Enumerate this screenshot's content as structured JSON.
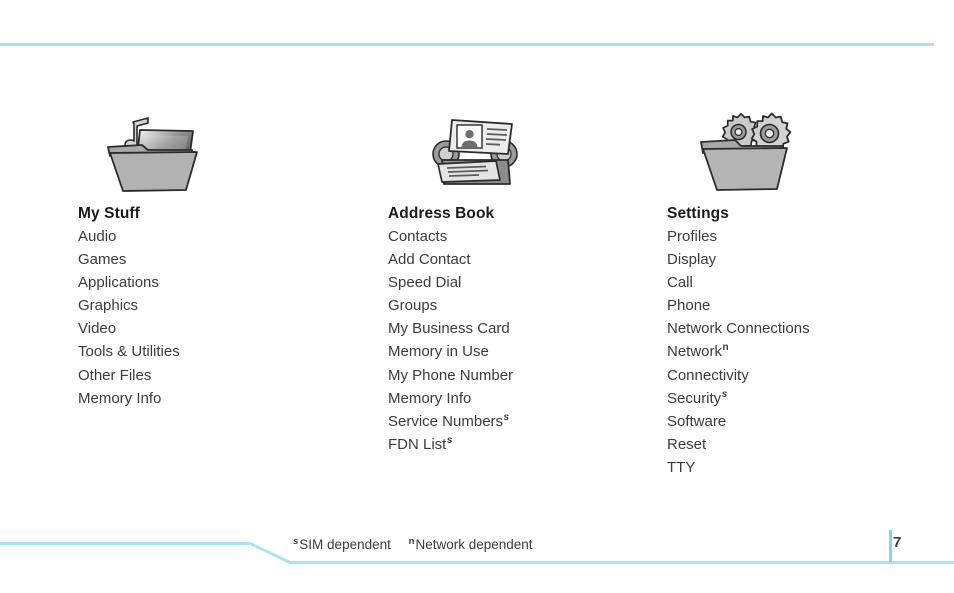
{
  "page": {
    "number": "7",
    "accent_color": "#a9e2f8",
    "text_color": "#3b3b3b"
  },
  "columns": [
    {
      "icon": "folder-media-icon",
      "title": "My Stuff",
      "items": [
        {
          "label": "Audio",
          "mark": ""
        },
        {
          "label": "Games",
          "mark": ""
        },
        {
          "label": "Applications",
          "mark": ""
        },
        {
          "label": "Graphics",
          "mark": ""
        },
        {
          "label": "Video",
          "mark": ""
        },
        {
          "label": "Tools & Utilities",
          "mark": ""
        },
        {
          "label": "Other Files",
          "mark": ""
        },
        {
          "label": "Memory Info",
          "mark": ""
        }
      ]
    },
    {
      "icon": "rolodex-card-file-icon",
      "title": "Address Book",
      "items": [
        {
          "label": "Contacts",
          "mark": ""
        },
        {
          "label": "Add Contact",
          "mark": ""
        },
        {
          "label": "Speed Dial",
          "mark": ""
        },
        {
          "label": "Groups",
          "mark": ""
        },
        {
          "label": "My Business Card",
          "mark": ""
        },
        {
          "label": "Memory in Use",
          "mark": ""
        },
        {
          "label": "My Phone Number",
          "mark": ""
        },
        {
          "label": "Memory Info",
          "mark": ""
        },
        {
          "label": "Service Numbers",
          "mark": "s"
        },
        {
          "label": "FDN List",
          "mark": "s"
        }
      ]
    },
    {
      "icon": "folder-gears-icon",
      "title": "Settings",
      "items": [
        {
          "label": "Profiles",
          "mark": ""
        },
        {
          "label": "Display",
          "mark": ""
        },
        {
          "label": "Call",
          "mark": ""
        },
        {
          "label": "Phone",
          "mark": ""
        },
        {
          "label": "Network Connections",
          "mark": ""
        },
        {
          "label": "Network",
          "mark": "n"
        },
        {
          "label": "Connectivity",
          "mark": ""
        },
        {
          "label": "Security",
          "mark": "s"
        },
        {
          "label": "Software",
          "mark": ""
        },
        {
          "label": "Reset",
          "mark": ""
        },
        {
          "label": "TTY",
          "mark": ""
        }
      ]
    }
  ],
  "legend": [
    {
      "mark": "s",
      "label": "SIM dependent"
    },
    {
      "mark": "n",
      "label": "Network dependent"
    }
  ]
}
